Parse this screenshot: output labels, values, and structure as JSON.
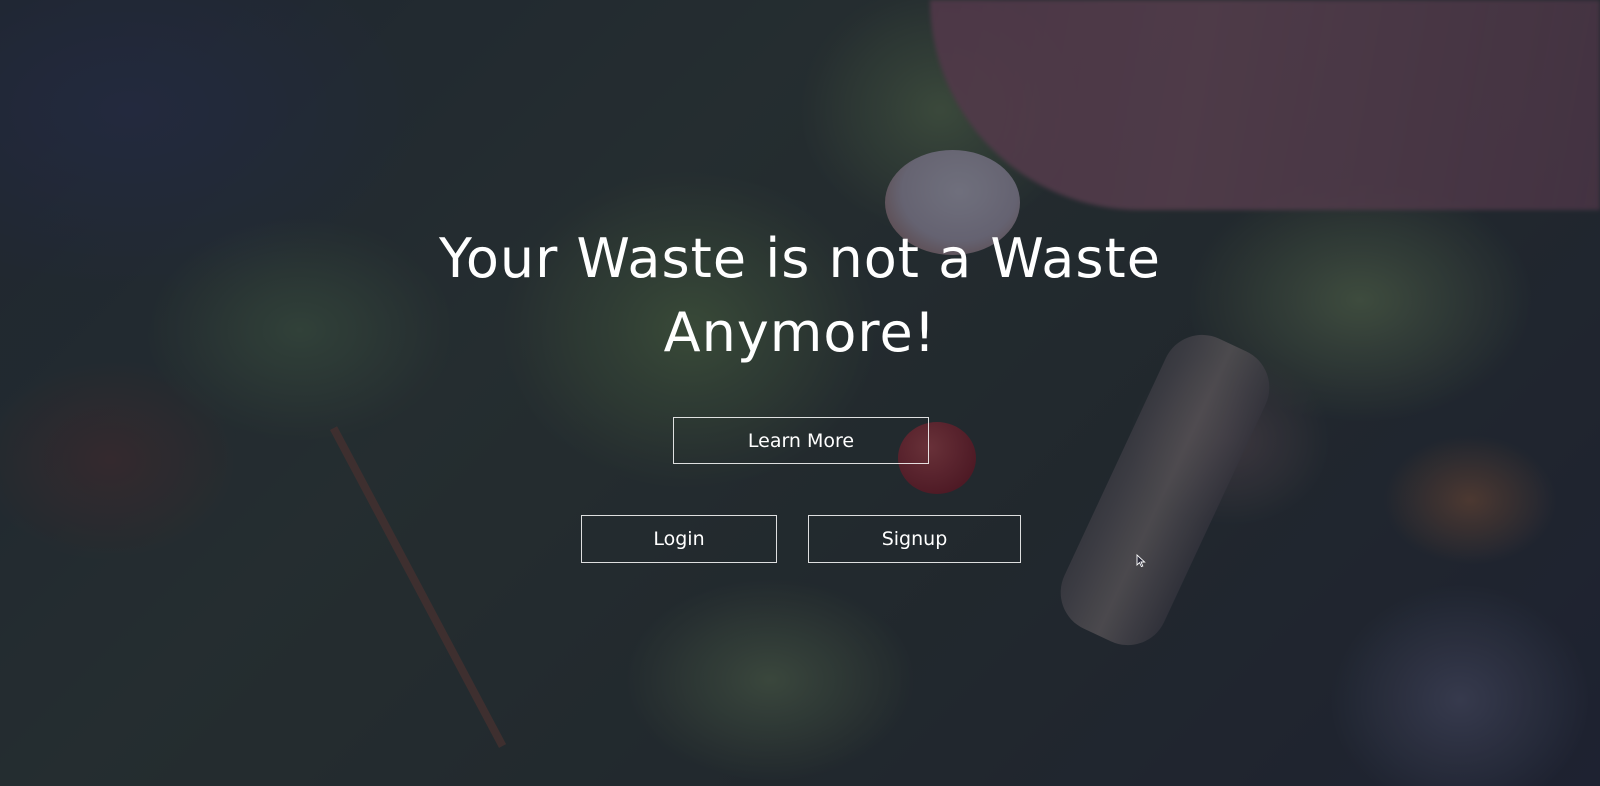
{
  "hero": {
    "title_line1": "Your Waste is not a Waste",
    "title_line2": "Anymore!",
    "background_image": "compost-vegetable-scraps-photo"
  },
  "buttons": {
    "learn_more": "Learn More",
    "login": "Login",
    "signup": "Signup"
  },
  "colors": {
    "overlay": "#12142c",
    "text": "#ffffff",
    "button_border": "#ffffff"
  }
}
